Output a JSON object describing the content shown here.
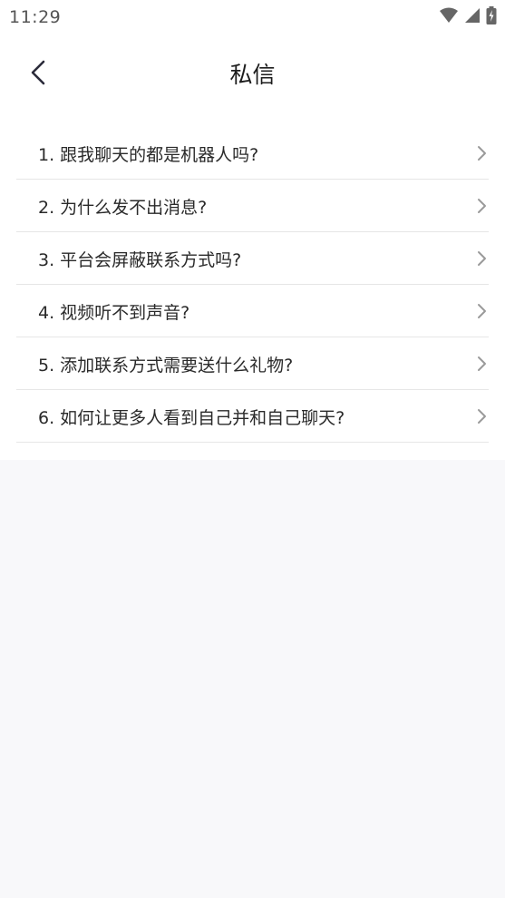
{
  "status_bar": {
    "time": "11:29",
    "icons": [
      "wifi-icon",
      "cellular-signal-icon",
      "battery-charging-icon"
    ]
  },
  "nav": {
    "back_icon": "chevron-left-icon",
    "title": "私信"
  },
  "faq": {
    "chevron_icon": "chevron-right-icon",
    "items": [
      {
        "label": "1. 跟我聊天的都是机器人吗?"
      },
      {
        "label": "2. 为什么发不出消息?"
      },
      {
        "label": "3. 平台会屏蔽联系方式吗?"
      },
      {
        "label": "4. 视频听不到声音?"
      },
      {
        "label": "5. 添加联系方式需要送什么礼物?"
      },
      {
        "label": "6. 如何让更多人看到自己并和自己聊天?"
      }
    ]
  },
  "colors": {
    "page_background": "#f8f8fa",
    "card_background": "#ffffff",
    "divider": "#e6e6e6",
    "chevron": "#9a9a9a"
  }
}
